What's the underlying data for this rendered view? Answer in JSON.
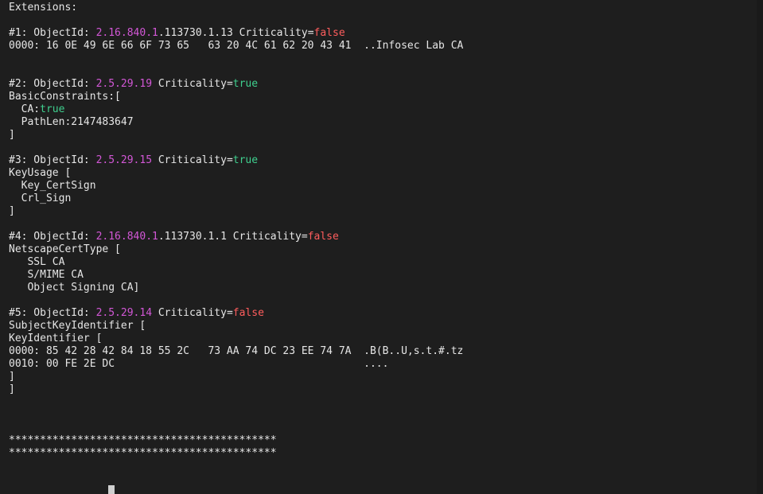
{
  "header": "Extensions:",
  "ext1": {
    "prefix": "#1: ObjectId: ",
    "oid_colored": "2.16.840.1",
    "oid_rest": ".113730.1.13 Criticality=",
    "crit": "false",
    "hex": "0000: 16 0E 49 6E 66 6F 73 65   63 20 4C 61 62 20 43 41  ..Infosec Lab CA"
  },
  "ext2": {
    "prefix": "#2: ObjectId: ",
    "oid_colored": "2.5.29.19",
    "oid_rest": " Criticality=",
    "crit": "true",
    "l1": "BasicConstraints:[",
    "l2_key": "  CA:",
    "l2_val": "true",
    "l3": "  PathLen:2147483647",
    "l4": "]"
  },
  "ext3": {
    "prefix": "#3: ObjectId: ",
    "oid_colored": "2.5.29.15",
    "oid_rest": " Criticality=",
    "crit": "true",
    "l1": "KeyUsage [",
    "l2": "  Key_CertSign",
    "l3": "  Crl_Sign",
    "l4": "]"
  },
  "ext4": {
    "prefix": "#4: ObjectId: ",
    "oid_colored": "2.16.840.1",
    "oid_rest": ".113730.1.1 Criticality=",
    "crit": "false",
    "l1": "NetscapeCertType [",
    "l2": "   SSL CA",
    "l3": "   S/MIME CA",
    "l4": "   Object Signing CA]"
  },
  "ext5": {
    "prefix": "#5: ObjectId: ",
    "oid_colored": "2.5.29.14",
    "oid_rest": " Criticality=",
    "crit": "false",
    "l1": "SubjectKeyIdentifier [",
    "l2": "KeyIdentifier [",
    "l3": "0000: 85 42 28 42 84 18 55 2C   73 AA 74 DC 23 EE 74 7A  .B(B..U,s.t.#.tz",
    "l4": "0010: 00 FE 2E DC                                        ....",
    "l5": "]",
    "l6": "]"
  },
  "stars1": "*******************************************",
  "stars2": "*******************************************",
  "prompt": "                "
}
